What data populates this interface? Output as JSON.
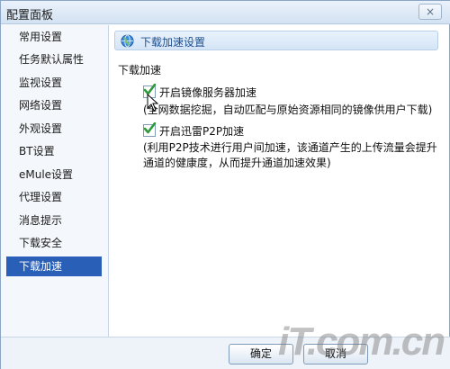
{
  "window": {
    "title": "配置面板",
    "close_label": "×"
  },
  "sidebar": {
    "items": [
      {
        "label": "常用设置"
      },
      {
        "label": "任务默认属性"
      },
      {
        "label": "监视设置"
      },
      {
        "label": "网络设置"
      },
      {
        "label": "外观设置"
      },
      {
        "label": "BT设置"
      },
      {
        "label": "eMule设置"
      },
      {
        "label": "代理设置"
      },
      {
        "label": "消息提示"
      },
      {
        "label": "下载安全"
      },
      {
        "label": "下载加速"
      }
    ],
    "active_index": 10
  },
  "content": {
    "header": "下载加速设置",
    "section_title": "下载加速",
    "options": [
      {
        "label": "开启镜像服务器加速",
        "checked": true,
        "description": "(全网数据挖掘，自动匹配与原始资源相同的镜像供用户下载)"
      },
      {
        "label": "开启迅雷P2P加速",
        "checked": true,
        "description_line1": "(利用P2P技术进行用户间加速，该通道产生的上传流量会提升",
        "description_line2": "通道的健康度，从而提升通道加速效果)"
      }
    ]
  },
  "footer": {
    "ok_label": "确定",
    "cancel_label": "取消"
  },
  "watermark": {
    "text": "iT.com.cn"
  },
  "colors": {
    "accent": "#2a5fb8",
    "check": "#2f9a3a"
  }
}
